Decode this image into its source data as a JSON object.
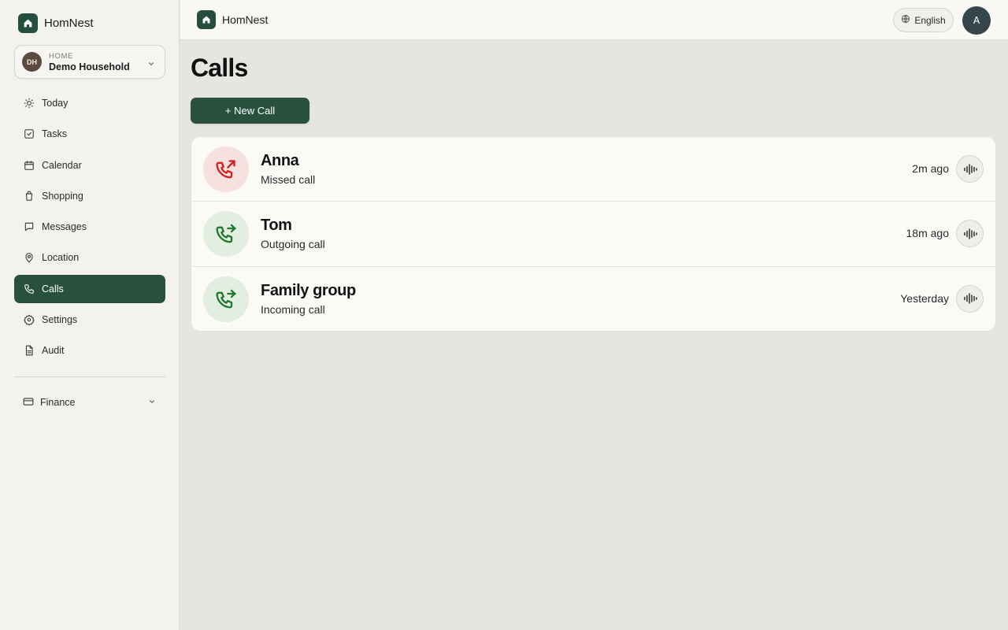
{
  "app": {
    "name": "HomNest"
  },
  "household": {
    "label": "HOME",
    "name": "Demo Household",
    "initials": "DH"
  },
  "nav": {
    "items": [
      {
        "label": "Today",
        "icon": "sun-icon"
      },
      {
        "label": "Tasks",
        "icon": "checkbox-icon"
      },
      {
        "label": "Calendar",
        "icon": "calendar-icon"
      },
      {
        "label": "Shopping",
        "icon": "shopping-bag-icon"
      },
      {
        "label": "Messages",
        "icon": "message-icon"
      },
      {
        "label": "Location",
        "icon": "map-pin-icon"
      },
      {
        "label": "Calls",
        "icon": "phone-icon",
        "active": true
      },
      {
        "label": "Settings",
        "icon": "gear-icon"
      },
      {
        "label": "Audit",
        "icon": "document-icon"
      }
    ],
    "finance": {
      "label": "Finance",
      "icon": "credit-card-icon"
    }
  },
  "header": {
    "brand": "HomNest",
    "language": "English",
    "user_initial": "A"
  },
  "main": {
    "title": "Calls",
    "new_call_label": "+ New Call",
    "calls": [
      {
        "name": "Anna",
        "type": "Missed call",
        "time": "2m ago",
        "status": "missed",
        "icon": "phone-missed-icon"
      },
      {
        "name": "Tom",
        "type": "Outgoing call",
        "time": "18m ago",
        "status": "outgoing",
        "icon": "phone-forward-icon"
      },
      {
        "name": "Family group",
        "type": "Incoming call",
        "time": "Yesterday",
        "status": "incoming",
        "icon": "phone-forward-icon"
      }
    ]
  },
  "colors": {
    "accent": "#27503f",
    "missed": "#d21f1f",
    "ok": "#1f7a2e"
  }
}
